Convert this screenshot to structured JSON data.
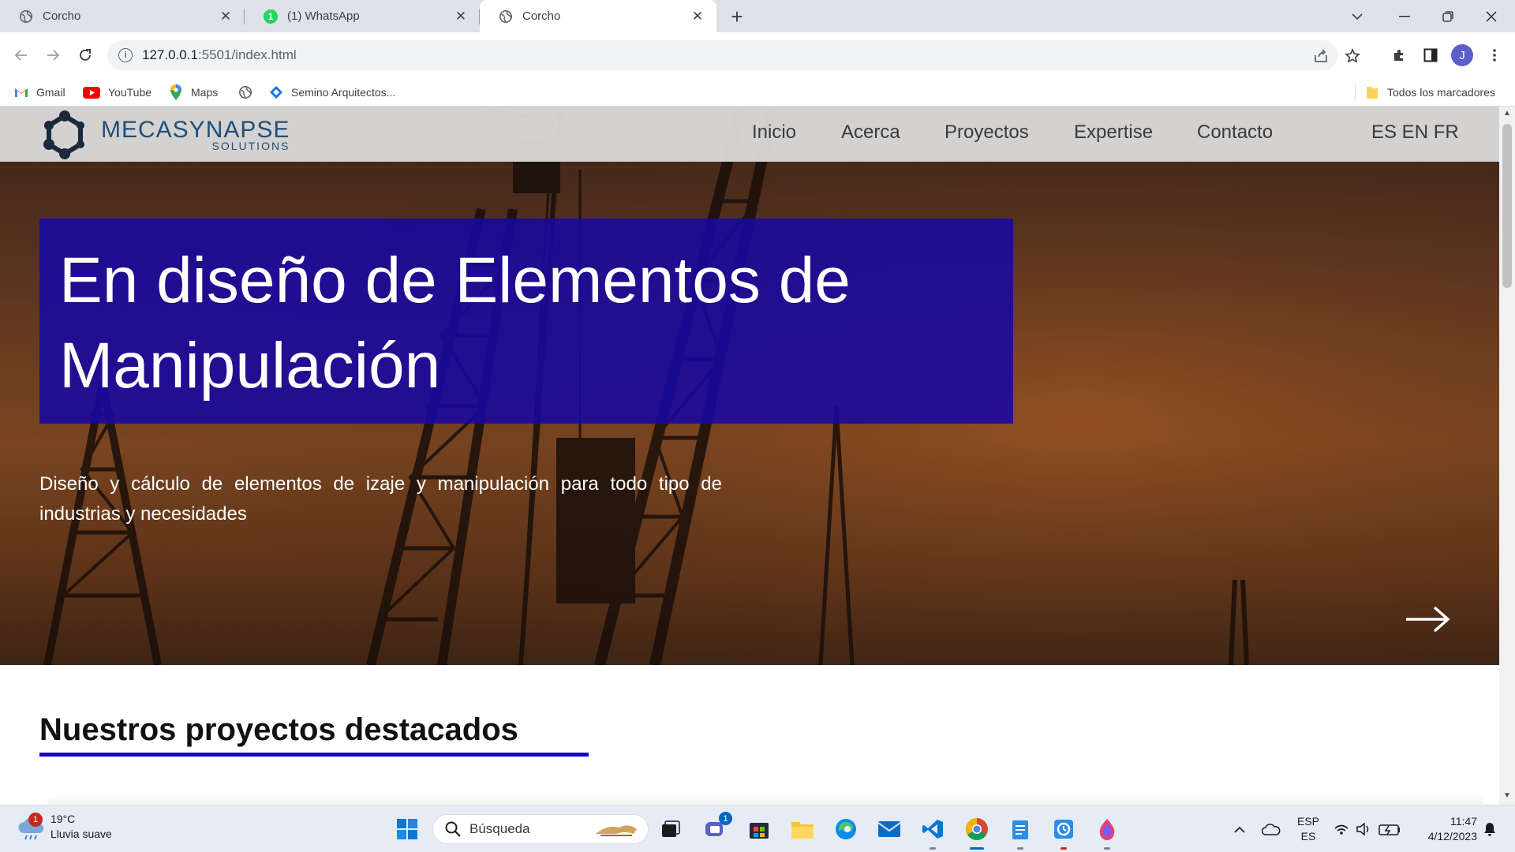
{
  "browser": {
    "tabs": [
      {
        "title": "Corcho",
        "active": false
      },
      {
        "title": "(1) WhatsApp",
        "active": false,
        "badge": "1"
      },
      {
        "title": "Corcho",
        "active": true
      }
    ],
    "new_tab_label": "+",
    "url_host": "127.0.0.1",
    "url_rest": ":5501/index.html",
    "profile_initial": "J",
    "bookmarks": [
      {
        "label": "Gmail",
        "icon": "gmail-icon"
      },
      {
        "label": "YouTube",
        "icon": "youtube-icon"
      },
      {
        "label": "Maps",
        "icon": "maps-icon"
      },
      {
        "label": "",
        "icon": "globe-icon"
      },
      {
        "label": "Semino Arquitectos...",
        "icon": "diamond-icon"
      }
    ],
    "all_bookmarks_label": "Todos los marcadores"
  },
  "site": {
    "logo_main": "MECASYNAPSE",
    "logo_sub": "SOLUTIONS",
    "nav": [
      "Inicio",
      "Acerca",
      "Proyectos",
      "Expertise",
      "Contacto"
    ],
    "languages": "ES EN FR",
    "hero_title": "En diseño de Elementos de Manipulación",
    "hero_subtitle": "Diseño y cálculo de elementos de izaje y manipulación para todo tipo de industrias y necesidades",
    "section_title": "Nuestros proyectos destacados",
    "colors": {
      "brand": "#1f4e79",
      "headline_bg": "#1808a0",
      "underline": "#1500c8"
    }
  },
  "taskbar": {
    "weather_temp": "19°C",
    "weather_desc": "Lluvia suave",
    "weather_badge": "1",
    "search_label": "Búsqueda",
    "teams_badge": "1",
    "lang_top": "ESP",
    "lang_bottom": "ES",
    "time": "11:47",
    "date": "4/12/2023"
  }
}
